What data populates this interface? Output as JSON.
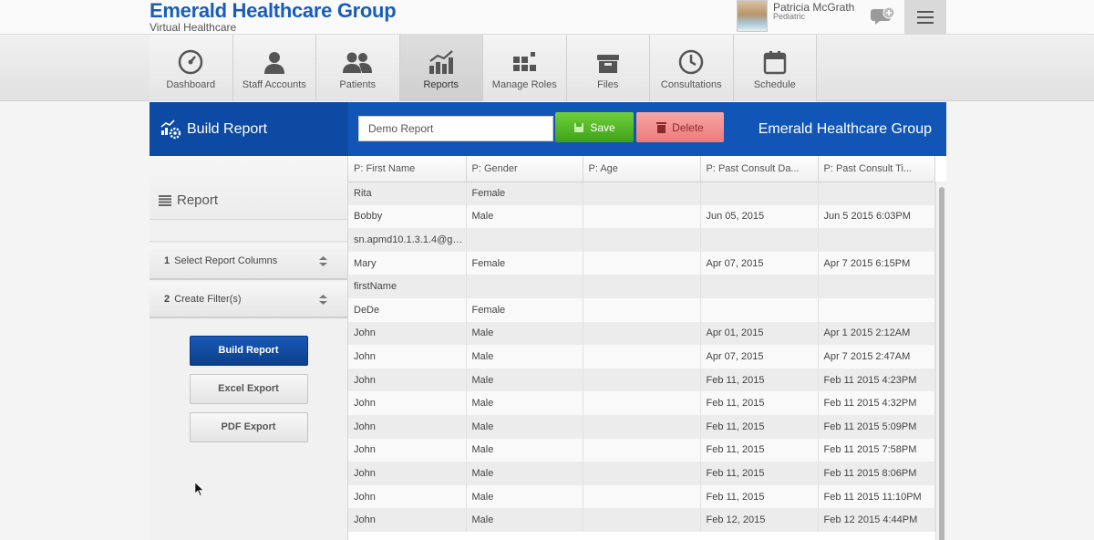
{
  "header": {
    "title": "Emerald Healthcare Group",
    "subtitle": "Virtual Healthcare",
    "user_name": "Patricia McGrath",
    "user_role": "Pediatric"
  },
  "nav": [
    {
      "label": "Dashboard",
      "icon": "dashboard-icon"
    },
    {
      "label": "Staff Accounts",
      "icon": "person-icon"
    },
    {
      "label": "Patients",
      "icon": "people-icon"
    },
    {
      "label": "Reports",
      "icon": "chart-icon",
      "active": true
    },
    {
      "label": "Manage Roles",
      "icon": "roles-icon"
    },
    {
      "label": "Files",
      "icon": "archive-icon"
    },
    {
      "label": "Consultations",
      "icon": "clock-icon"
    },
    {
      "label": "Schedule",
      "icon": "calendar-icon"
    }
  ],
  "toolbar": {
    "title": "Build Report",
    "report_name": "Demo Report",
    "save_label": "Save",
    "delete_label": "Delete",
    "org_name": "Emerald Healthcare Group"
  },
  "left": {
    "report_title": "Report",
    "step1_num": "1",
    "step1_label": "Select Report Columns",
    "step2_num": "2",
    "step2_label": "Create Filter(s)",
    "build_label": "Build Report",
    "excel_label": "Excel Export",
    "pdf_label": "PDF Export"
  },
  "table": {
    "columns": [
      "P: First Name",
      "P: Gender",
      "P: Age",
      "P: Past Consult Da...",
      "P: Past Consult Ti..."
    ],
    "rows": [
      [
        "Rita",
        "Female",
        "",
        "",
        ""
      ],
      [
        "Bobby",
        "Male",
        "",
        "Jun 05, 2015",
        "Jun 5 2015 6:03PM"
      ],
      [
        "sn.apmd10.1.3.1.4@gm...",
        "",
        "",
        "",
        ""
      ],
      [
        "Mary",
        "Female",
        "",
        "Apr 07, 2015",
        "Apr 7 2015 6:15PM"
      ],
      [
        "firstName",
        "",
        "",
        "",
        ""
      ],
      [
        "DeDe",
        "Female",
        "",
        "",
        ""
      ],
      [
        "John",
        "Male",
        "",
        "Apr 01, 2015",
        "Apr 1 2015 2:12AM"
      ],
      [
        "John",
        "Male",
        "",
        "Apr 07, 2015",
        "Apr 7 2015 2:47AM"
      ],
      [
        "John",
        "Male",
        "",
        "Feb 11, 2015",
        "Feb 11 2015 4:23PM"
      ],
      [
        "John",
        "Male",
        "",
        "Feb 11, 2015",
        "Feb 11 2015 4:32PM"
      ],
      [
        "John",
        "Male",
        "",
        "Feb 11, 2015",
        "Feb 11 2015 5:09PM"
      ],
      [
        "John",
        "Male",
        "",
        "Feb 11, 2015",
        "Feb 11 2015 7:58PM"
      ],
      [
        "John",
        "Male",
        "",
        "Feb 11, 2015",
        "Feb 11 2015 8:06PM"
      ],
      [
        "John",
        "Male",
        "",
        "Feb 11, 2015",
        "Feb 11 2015 11:10PM"
      ],
      [
        "John",
        "Male",
        "",
        "Feb 12, 2015",
        "Feb 12 2015 4:44PM"
      ]
    ]
  },
  "colors": {
    "brand_blue": "#1a5db8",
    "bar_blue": "#1155b7",
    "save_green": "#4fb325",
    "delete_red": "#ee7a7a"
  }
}
